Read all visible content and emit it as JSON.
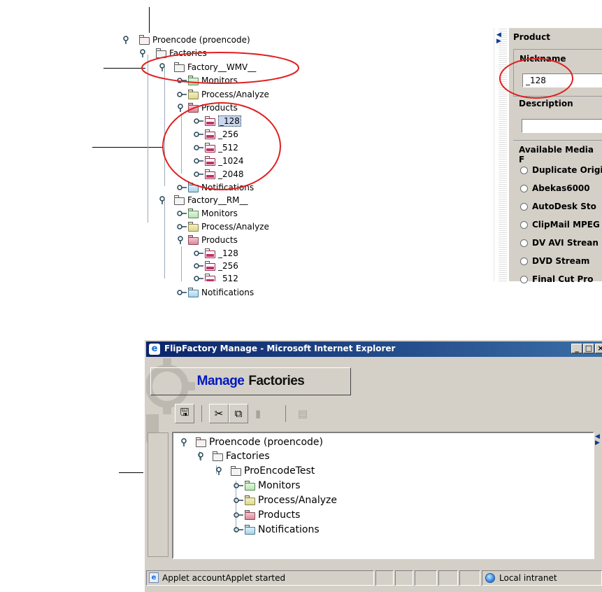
{
  "colors": {
    "callout_red": "#e02020",
    "ie_title_start": "#0a246a",
    "ie_title_end": "#3a6ea5",
    "manage_blue": "#0018c0",
    "panel_gray": "#d4d0c8"
  },
  "top_tree": {
    "root": "Proencode (proencode)",
    "factories": "Factories",
    "factory_wmv": {
      "label": "Factory__WMV__",
      "monitors": "Monitors",
      "process": "Process/Analyze",
      "products": "Products",
      "product_items": [
        "_128",
        "_256",
        "_512",
        "_1024",
        "_2048"
      ],
      "notifications": "Notifications"
    },
    "factory_rm": {
      "label": "Factory__RM__",
      "monitors": "Monitors",
      "process": "Process/Analyze",
      "products": "Products",
      "product_items": [
        "_128",
        "_256",
        "_512"
      ],
      "notifications": "Notifications"
    }
  },
  "product_panel": {
    "group_title": "Product",
    "nickname_label": "Nickname",
    "nickname_value": "_128",
    "description_label": "Description",
    "description_value": "",
    "media_label": "Available Media F",
    "media_options": [
      "Duplicate Origi",
      "Abekas6000",
      "AutoDesk Sto",
      "ClipMail MPEG",
      "DV AVI Strean",
      "DVD Stream",
      "Final Cut Pro"
    ]
  },
  "ie_window": {
    "title": "FlipFactory Manage - Microsoft Internet Explorer",
    "banner_word1": "Manage",
    "banner_word2": "Factories",
    "tree": {
      "root": "Proencode (proencode)",
      "factories": "Factories",
      "factory": "ProEncodeTest",
      "monitors": "Monitors",
      "process": "Process/Analyze",
      "products": "Products",
      "notifications": "Notifications"
    },
    "status_text": "Applet accountApplet started",
    "zone_text": "Local intranet"
  },
  "icons": [
    "tree-handle-icon",
    "folder-icon",
    "save-icon",
    "cut-icon",
    "copy-icon",
    "paste-icon",
    "delete-icon",
    "ie-logo-icon",
    "globe-icon",
    "radio-icon"
  ]
}
